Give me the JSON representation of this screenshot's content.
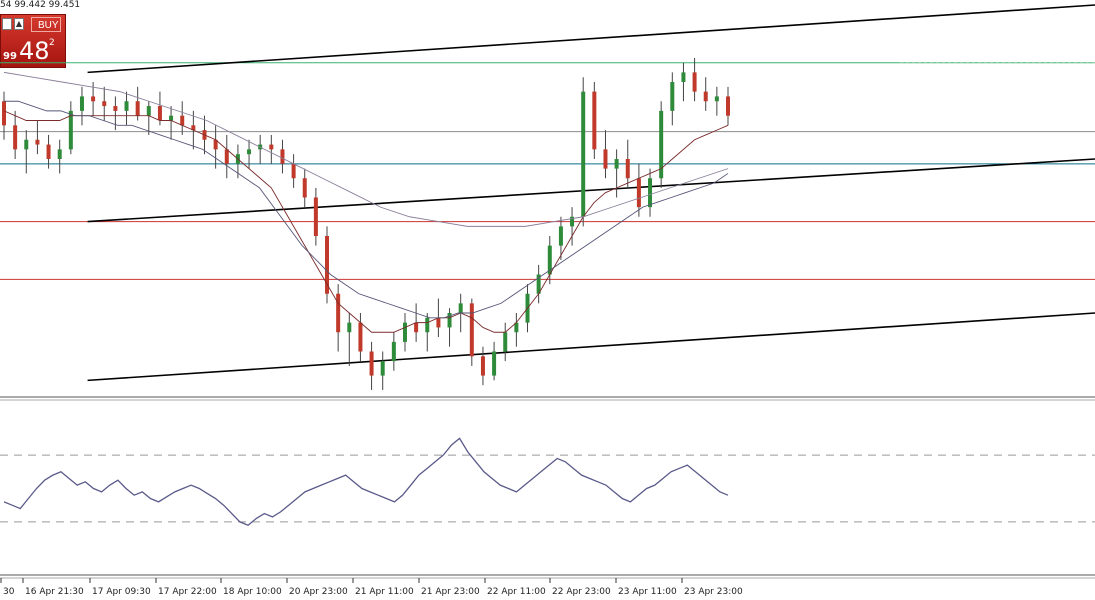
{
  "header": {
    "ohlc_text": "54 99.442 99.451",
    "buy_label": "BUY",
    "bid_small": "99",
    "bid_big": "48",
    "bid_sup": "2"
  },
  "chart_data": [
    {
      "type": "candlestick",
      "x_ticks": [
        "30",
        "16 Apr 21:30",
        "17 Apr 09:30",
        "17 Apr 22:00",
        "18 Apr 10:00",
        "20 Apr 23:00",
        "21 Apr 11:00",
        "21 Apr 23:00",
        "22 Apr 11:00",
        "22 Apr 23:00",
        "23 Apr 11:00",
        "23 Apr 23:00"
      ],
      "bars": [
        [
          99.6,
          99.62,
          99.52,
          99.55
        ],
        [
          99.55,
          99.58,
          99.48,
          99.5
        ],
        [
          99.5,
          99.54,
          99.45,
          99.52
        ],
        [
          99.52,
          99.56,
          99.49,
          99.51
        ],
        [
          99.51,
          99.53,
          99.46,
          99.48
        ],
        [
          99.48,
          99.52,
          99.45,
          99.5
        ],
        [
          99.5,
          99.6,
          99.49,
          99.58
        ],
        [
          99.58,
          99.63,
          99.55,
          99.61
        ],
        [
          99.61,
          99.64,
          99.57,
          99.6
        ],
        [
          99.6,
          99.63,
          99.56,
          99.59
        ],
        [
          99.59,
          99.61,
          99.54,
          99.58
        ],
        [
          99.58,
          99.62,
          99.55,
          99.6
        ],
        [
          99.6,
          99.63,
          99.56,
          99.57
        ],
        [
          99.57,
          99.6,
          99.53,
          99.59
        ],
        [
          99.59,
          99.62,
          99.55,
          99.56
        ],
        [
          99.56,
          99.59,
          99.52,
          99.57
        ],
        [
          99.57,
          99.6,
          99.53,
          99.55
        ],
        [
          99.55,
          99.58,
          99.5,
          99.54
        ],
        [
          99.54,
          99.57,
          99.49,
          99.52
        ],
        [
          99.52,
          99.55,
          99.46,
          99.5
        ],
        [
          99.5,
          99.53,
          99.44,
          99.47
        ],
        [
          99.47,
          99.51,
          99.44,
          99.49
        ],
        [
          99.49,
          99.52,
          99.46,
          99.5
        ],
        [
          99.5,
          99.53,
          99.47,
          99.51
        ],
        [
          99.51,
          99.53,
          99.47,
          99.5
        ],
        [
          99.5,
          99.52,
          99.45,
          99.47
        ],
        [
          99.47,
          99.49,
          99.42,
          99.44
        ],
        [
          99.44,
          99.46,
          99.38,
          99.4
        ],
        [
          99.4,
          99.42,
          99.3,
          99.32
        ],
        [
          99.32,
          99.34,
          99.18,
          99.2
        ],
        [
          99.2,
          99.22,
          99.08,
          99.12
        ],
        [
          99.12,
          99.16,
          99.05,
          99.14
        ],
        [
          99.14,
          99.16,
          99.06,
          99.08
        ],
        [
          99.08,
          99.1,
          99.0,
          99.03
        ],
        [
          99.03,
          99.08,
          99.0,
          99.06
        ],
        [
          99.06,
          99.12,
          99.04,
          99.1
        ],
        [
          99.1,
          99.16,
          99.08,
          99.14
        ],
        [
          99.14,
          99.18,
          99.1,
          99.12
        ],
        [
          99.12,
          99.16,
          99.08,
          99.15
        ],
        [
          99.15,
          99.19,
          99.11,
          99.13
        ],
        [
          99.13,
          99.17,
          99.09,
          99.16
        ],
        [
          99.16,
          99.2,
          99.12,
          99.18
        ],
        [
          99.18,
          99.19,
          99.05,
          99.07
        ],
        [
          99.07,
          99.09,
          99.01,
          99.03
        ],
        [
          99.03,
          99.1,
          99.02,
          99.08
        ],
        [
          99.08,
          99.14,
          99.06,
          99.12
        ],
        [
          99.12,
          99.16,
          99.09,
          99.14
        ],
        [
          99.14,
          99.22,
          99.12,
          99.2
        ],
        [
          99.2,
          99.26,
          99.18,
          99.24
        ],
        [
          99.24,
          99.32,
          99.22,
          99.3
        ],
        [
          99.3,
          99.36,
          99.27,
          99.34
        ],
        [
          99.34,
          99.38,
          99.3,
          99.36
        ],
        [
          99.36,
          99.65,
          99.34,
          99.62
        ],
        [
          99.62,
          99.64,
          99.48,
          99.5
        ],
        [
          99.5,
          99.54,
          99.44,
          99.46
        ],
        [
          99.46,
          99.5,
          99.4,
          99.48
        ],
        [
          99.48,
          99.52,
          99.42,
          99.44
        ],
        [
          99.44,
          99.47,
          99.36,
          99.38
        ],
        [
          99.38,
          99.46,
          99.36,
          99.44
        ],
        [
          99.44,
          99.6,
          99.42,
          99.58
        ],
        [
          99.58,
          99.66,
          99.55,
          99.64
        ],
        [
          99.64,
          99.68,
          99.6,
          99.66
        ],
        [
          99.66,
          99.69,
          99.6,
          99.62
        ],
        [
          99.62,
          99.65,
          99.58,
          99.6
        ],
        [
          99.6,
          99.63,
          99.57,
          99.61
        ],
        [
          99.61,
          99.63,
          99.55,
          99.57
        ]
      ],
      "horizontal_lines": [
        {
          "y": 99.68,
          "color": "#3cb371",
          "style": "solid"
        },
        {
          "y": 99.537,
          "color": "#8c8c8c",
          "style": "solid"
        },
        {
          "y": 99.47,
          "color": "#0a6f8a",
          "style": "solid"
        },
        {
          "y": 99.35,
          "color": "#cc3333",
          "style": "solid"
        },
        {
          "y": 99.23,
          "color": "#cc3333",
          "style": "solid"
        }
      ],
      "channel_lines": [
        {
          "x1": 0.08,
          "y1": 99.66,
          "x2": 1.0,
          "y2": 99.8
        },
        {
          "x1": 0.08,
          "y1": 99.35,
          "x2": 1.0,
          "y2": 99.48
        },
        {
          "x1": 0.08,
          "y1": 99.02,
          "x2": 1.0,
          "y2": 99.16
        }
      ],
      "moving_averages": [
        {
          "color": "#7a2b2b",
          "values": [
            99.58,
            99.57,
            99.56,
            99.56,
            99.56,
            99.56,
            99.57,
            99.57,
            99.57,
            99.57,
            99.57,
            99.57,
            99.57,
            99.57,
            99.56,
            99.56,
            99.55,
            99.54,
            99.53,
            99.52,
            99.5,
            99.48,
            99.46,
            99.44,
            99.42,
            99.38,
            99.34,
            99.3,
            99.26,
            99.22,
            99.18,
            99.16,
            99.14,
            99.12,
            99.12,
            99.12,
            99.13,
            99.14,
            99.14,
            99.15,
            99.15,
            99.16,
            99.15,
            99.13,
            99.12,
            99.12,
            99.14,
            99.17,
            99.2,
            99.24,
            99.28,
            99.32,
            99.36,
            99.39,
            99.41,
            99.42,
            99.43,
            99.44,
            99.45,
            99.46,
            99.48,
            99.5,
            99.52,
            99.53,
            99.54,
            99.55
          ]
        },
        {
          "color": "#555577",
          "values": [
            99.6,
            99.6,
            99.59,
            99.58,
            99.58,
            99.57,
            99.57,
            99.56,
            99.55,
            99.55,
            99.54,
            99.53,
            99.52,
            99.51,
            99.5,
            99.48,
            99.46,
            99.44,
            99.42,
            99.38,
            99.34,
            99.3,
            99.27,
            99.24,
            99.22,
            99.2,
            99.19,
            99.18,
            99.17,
            99.16,
            99.15,
            99.15,
            99.16,
            99.16,
            99.17,
            99.18,
            99.2,
            99.22,
            99.24,
            99.26,
            99.28,
            99.3,
            99.32,
            99.34,
            99.36,
            99.38,
            99.39,
            99.4,
            99.41,
            99.42,
            99.43,
            99.45
          ]
        },
        {
          "color": "#8a7f9a",
          "values": [
            99.66,
            99.65,
            99.64,
            99.63,
            99.62,
            99.6,
            99.58,
            99.56,
            99.53,
            99.5,
            99.47,
            99.44,
            99.41,
            99.38,
            99.36,
            99.35,
            99.34,
            99.34,
            99.34,
            99.35,
            99.36,
            99.38,
            99.4,
            99.42,
            99.44,
            99.46
          ]
        }
      ]
    },
    {
      "type": "line",
      "levels": [
        70,
        30
      ],
      "ylim": [
        0,
        100
      ],
      "values": [
        42,
        40,
        38,
        44,
        50,
        55,
        58,
        60,
        56,
        52,
        54,
        50,
        48,
        52,
        55,
        50,
        46,
        48,
        44,
        42,
        45,
        48,
        50,
        52,
        50,
        47,
        44,
        40,
        35,
        30,
        28,
        32,
        35,
        33,
        36,
        40,
        44,
        48,
        50,
        52,
        54,
        56,
        58,
        54,
        50,
        48,
        46,
        44,
        42,
        46,
        52,
        58,
        62,
        66,
        70,
        76,
        80,
        72,
        66,
        60,
        56,
        52,
        50,
        48,
        52,
        56,
        60,
        64,
        68,
        66,
        62,
        58,
        56,
        54,
        52,
        48,
        44,
        42,
        46,
        50,
        52,
        56,
        60,
        62,
        64,
        60,
        56,
        52,
        48,
        46
      ]
    }
  ]
}
